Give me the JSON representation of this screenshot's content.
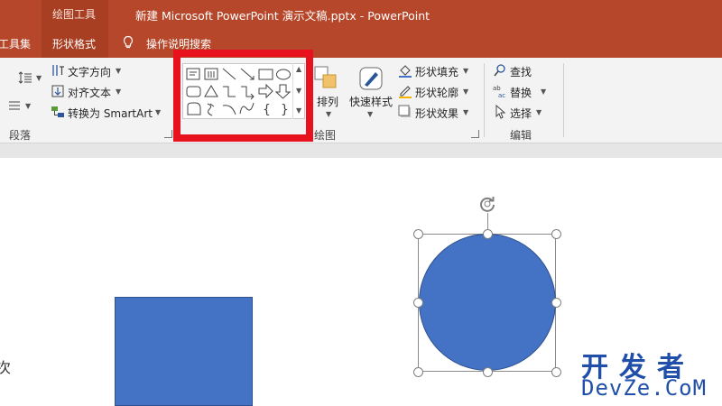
{
  "titlebar": {
    "context_group": "绘图工具",
    "document_title": "新建 Microsoft PowerPoint 演示文稿.pptx  -  PowerPoint"
  },
  "tabs": {
    "tools": "工具集",
    "shape_format": "形状格式",
    "tell_me": "操作说明搜索"
  },
  "ribbon": {
    "paragraph": {
      "text_direction": "文字方向",
      "align_text": "对齐文本",
      "convert_smartart": "转换为 SmartArt",
      "label": "段落"
    },
    "drawing": {
      "arrange": "排列",
      "quick_styles": "快速样式",
      "shape_fill": "形状填充",
      "shape_outline": "形状轮廓",
      "shape_effects": "形状效果",
      "label": "绘图"
    },
    "editing": {
      "find": "查找",
      "replace": "替换",
      "select": "选择",
      "label": "编辑"
    },
    "shape_gallery_icons": [
      "text-box-icon",
      "vertical-text-box-icon",
      "line-icon",
      "arrow-line-icon",
      "rectangle-icon",
      "oval-icon",
      "rounded-rectangle-icon",
      "triangle-icon",
      "elbow-connector-icon",
      "elbow-arrow-connector-icon",
      "right-arrow-icon",
      "down-arrow-icon",
      "freeform-icon",
      "scribble-icon",
      "arc-icon",
      "curve-icon",
      "left-brace-icon",
      "right-brace-icon"
    ]
  },
  "canvas": {
    "side_text": "次",
    "shape_fill_color": "#4472c4"
  },
  "watermark": {
    "cn": "开发者",
    "en": "DevZe.CoM"
  },
  "colors": {
    "accent": "#b7472a",
    "highlight": "#e8121f"
  }
}
